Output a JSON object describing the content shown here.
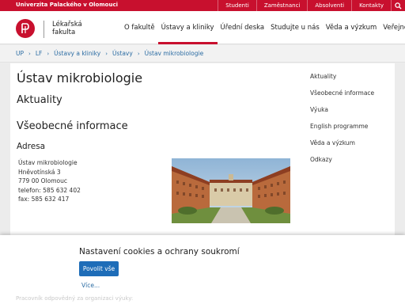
{
  "topbar": {
    "university": "Univerzita Palackého v Olomouci",
    "links": [
      "Studenti",
      "Zaměstnanci",
      "Absolventi",
      "Kontakty"
    ],
    "search_icon": "search-icon"
  },
  "header": {
    "faculty_line1": "Lékařská",
    "faculty_line2": "fakulta",
    "nav": [
      "O fakultě",
      "Ústavy a kliniky",
      "Úřední deska",
      "Studujte u nás",
      "Věda a výzkum",
      "Veřejnost"
    ],
    "active_nav": "Ústavy a kliniky"
  },
  "breadcrumb": [
    "UP",
    "LF",
    "Ústavy a kliniky",
    "Ústavy",
    "Ústav mikrobiologie"
  ],
  "main": {
    "title": "Ústav mikrobiologie",
    "section1": "Aktuality",
    "section2": "Všeobecné informace",
    "address_heading": "Adresa",
    "address_lines": [
      "Ústav mikrobiologie",
      "Hněvotínská 3",
      "779 00 Olomouc",
      "telefon: 585 632 402",
      "fax: 585 632 417"
    ]
  },
  "sidebar": {
    "items": [
      "Aktuality",
      "Všeobecné informace",
      "Výuka",
      "English programme",
      "Věda a výzkum",
      "Odkazy"
    ]
  },
  "cookie": {
    "title": "Nastavení cookies a ochrany soukromí",
    "accept_label": "Povolit vše",
    "more_label": "Více...",
    "background_text": "Pracovník odpovědný za organizaci výuky:"
  },
  "colors": {
    "brand_red": "#c8102e",
    "link_blue": "#2b6ca3",
    "button_blue": "#1e6db8"
  }
}
